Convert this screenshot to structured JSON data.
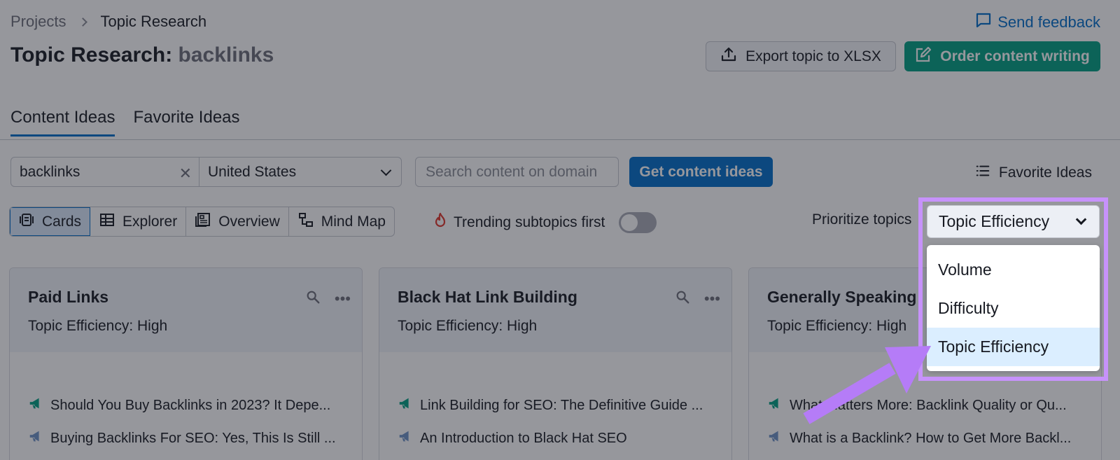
{
  "header": {
    "breadcrumb": [
      "Projects",
      "Topic Research"
    ],
    "feedback_label": "Send feedback",
    "title_prefix": "Topic Research:",
    "title_keyword": "backlinks",
    "export_label": "Export topic to XLSX",
    "order_label": "Order content writing"
  },
  "tabs": [
    {
      "label": "Content Ideas",
      "active": true
    },
    {
      "label": "Favorite Ideas",
      "active": false
    }
  ],
  "filters": {
    "keyword_value": "backlinks",
    "country_value": "United States",
    "domain_placeholder": "Search content on domain",
    "get_ideas_label": "Get content ideas",
    "favorite_ideas_label": "Favorite Ideas"
  },
  "views": [
    {
      "label": "Cards",
      "icon": "cards-icon",
      "active": true
    },
    {
      "label": "Explorer",
      "icon": "table-icon",
      "active": false
    },
    {
      "label": "Overview",
      "icon": "overview-icon",
      "active": false
    },
    {
      "label": "Mind Map",
      "icon": "mind-map-icon",
      "active": false
    }
  ],
  "trending": {
    "label": "Trending subtopics first",
    "enabled": false
  },
  "prioritize": {
    "label": "Prioritize topics",
    "selected": "Topic Efficiency",
    "options": [
      "Volume",
      "Difficulty",
      "Topic Efficiency"
    ]
  },
  "cards": [
    {
      "title": "Paid Links",
      "efficiency": "Topic Efficiency: High",
      "headlines": [
        "Should You Buy Backlinks in 2023? It Depe...",
        "Buying Backlinks For SEO: Yes, This Is Still ..."
      ]
    },
    {
      "title": "Black Hat Link Building",
      "efficiency": "Topic Efficiency: High",
      "headlines": [
        "Link Building for SEO: The Definitive Guide ...",
        "An Introduction to Black Hat SEO"
      ]
    },
    {
      "title": "Generally Speaking",
      "efficiency": "Topic Efficiency: High",
      "headlines": [
        "What Matters More: Backlink Quality or Qu...",
        "What is a Backlink? How to Get More Backl..."
      ]
    }
  ],
  "colors": {
    "accent_blue": "#006dca",
    "accent_green": "#009f81",
    "highlight_purple": "#c792fb",
    "annotation_arrow": "#b57cf7"
  }
}
